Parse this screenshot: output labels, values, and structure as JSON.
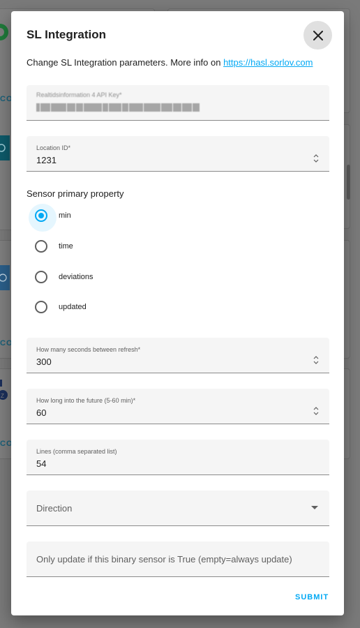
{
  "background": {
    "config_label": "CONFIGURE"
  },
  "dialog": {
    "title": "SL Integration",
    "intro_text": "Change SL Integration parameters. More info on ",
    "intro_link": "https://hasl.sorlov.com",
    "api_key_field": {
      "label": "Realtidsinformation 4 API Key*"
    },
    "location_field": {
      "label": "Location ID*",
      "value": "1231"
    },
    "sensor_section": {
      "label": "Sensor primary property",
      "options": [
        {
          "label": "min",
          "checked": true
        },
        {
          "label": "time",
          "checked": false
        },
        {
          "label": "deviations",
          "checked": false
        },
        {
          "label": "updated",
          "checked": false
        }
      ]
    },
    "refresh_field": {
      "label": "How many seconds between refresh*",
      "value": "300"
    },
    "future_field": {
      "label": "How long into the future (5-60 min)*",
      "value": "60"
    },
    "lines_field": {
      "label": "Lines (comma separated list)",
      "value": "54"
    },
    "direction_field": {
      "label": "Direction"
    },
    "binary_sensor_field": {
      "placeholder": "Only update if this binary sensor is True (empty=always update)"
    },
    "submit_label": "SUBMIT"
  },
  "colors": {
    "accent": "#03a9f4",
    "text": "#212121",
    "field_bg": "#f5f5f5"
  }
}
